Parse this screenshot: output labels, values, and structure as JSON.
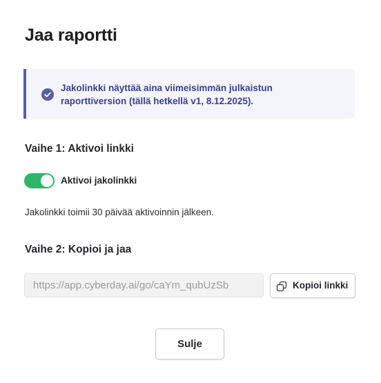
{
  "dialog": {
    "title": "Jaa raportti",
    "info": {
      "icon": "check-circle-icon",
      "text_line1": "Jakolinkki näyttää aina viimeisimmän julkaistun",
      "text_line2": "raporttiversion (tällä hetkellä v1, 8.12.2025)."
    },
    "step1": {
      "heading": "Vaihe 1: Aktivoi linkki",
      "toggle_label": "Aktivoi jakolinkki",
      "toggle_on": true,
      "note": "Jakolinkki toimii 30 päivää aktivoinnin jälkeen."
    },
    "step2": {
      "heading": "Vaihe 2: Kopioi ja jaa",
      "url_value": "https://app.cyberday.ai/go/caYm_qubUzSb",
      "copy_icon": "copy-icon",
      "copy_label": "Kopioi linkki"
    },
    "close_label": "Sulje"
  },
  "colors": {
    "accent": "#5b5ea6",
    "info_text": "#3c3f8c",
    "info_bg": "#f4f5fb",
    "toggle_on": "#2fb566"
  }
}
